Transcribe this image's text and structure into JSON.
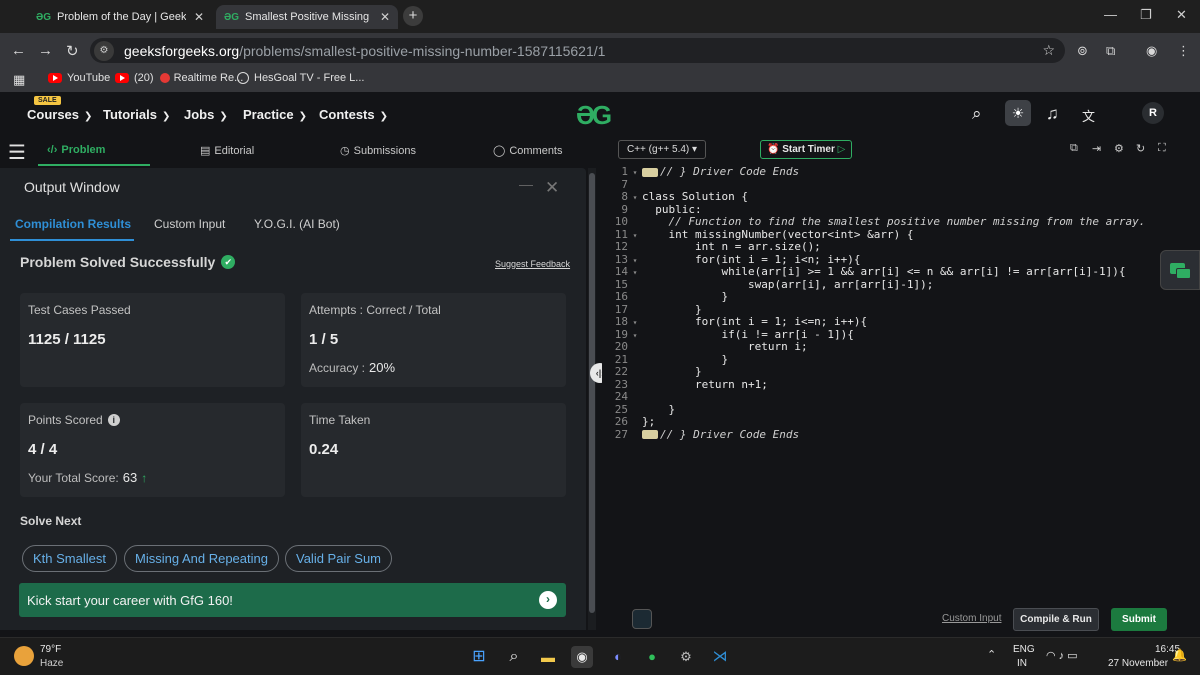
{
  "browser": {
    "tabs": [
      {
        "label": "Problem of the Day | GeeksforG",
        "active": false
      },
      {
        "label": "Smallest Positive Missing Numb",
        "active": true
      }
    ],
    "url_domain": "geeksforgeeks.org",
    "url_path": "/problems/smallest-positive-missing-number-1587115621/1",
    "bookmarks": [
      {
        "label": "YouTube",
        "icon": "youtube-icon"
      },
      {
        "label": "(20)",
        "icon": "youtube-icon"
      },
      {
        "label": "Realtime Re...",
        "icon": "red-dot-icon"
      },
      {
        "label": "HesGoal TV - Free L...",
        "icon": "globe-icon"
      }
    ]
  },
  "site_header": {
    "sale_badge": "SALE",
    "menus": [
      "Courses",
      "Tutorials",
      "Jobs",
      "Practice",
      "Contests"
    ],
    "logo": "GfG",
    "avatar_initial": "R"
  },
  "problem_tabs": {
    "problem": "Problem",
    "editorial": "Editorial",
    "submissions": "Submissions",
    "comments": "Comments"
  },
  "output_window": {
    "title": "Output Window",
    "tabs": [
      "Compilation Results",
      "Custom Input",
      "Y.O.G.I. (AI Bot)"
    ],
    "status": "Problem Solved Successfully",
    "suggest_feedback": "Suggest Feedback",
    "cards": {
      "test_cases_label": "Test Cases Passed",
      "test_cases_value": "1125 / 1125",
      "attempts_label": "Attempts : Correct / Total",
      "attempts_value": "1 / 5",
      "accuracy_label": "Accuracy :",
      "accuracy_value": "20%",
      "points_label": "Points Scored",
      "points_value": "4 / 4",
      "total_score_label": "Your Total Score:",
      "total_score_value": "63",
      "time_label": "Time Taken",
      "time_value": "0.24"
    },
    "solve_next_label": "Solve Next",
    "solve_next": [
      "Kth Smallest",
      "Missing And Repeating",
      "Valid Pair Sum"
    ],
    "banner": "Kick start your career with GfG 160!"
  },
  "editor": {
    "language": "C++ (g++ 5.4)",
    "start_timer": "Start Timer",
    "custom_input": "Custom Input",
    "compile_run": "Compile & Run",
    "submit": "Submit"
  },
  "code_lines": [
    {
      "n": "1",
      "text": "// } Driver Code Ends",
      "fold": true,
      "collapsed": true
    },
    {
      "n": "7",
      "text": "",
      "fold": false
    },
    {
      "n": "8",
      "text": "class Solution {",
      "fold": true
    },
    {
      "n": "9",
      "text": "  public:",
      "fold": false
    },
    {
      "n": "10",
      "text": "    // Function to find the smallest positive number missing from the array.",
      "fold": false
    },
    {
      "n": "11",
      "text": "    int missingNumber(vector<int> &arr) {",
      "fold": true
    },
    {
      "n": "12",
      "text": "        int n = arr.size();",
      "fold": false
    },
    {
      "n": "13",
      "text": "        for(int i = 1; i<n; i++){",
      "fold": true
    },
    {
      "n": "14",
      "text": "            while(arr[i] >= 1 && arr[i] <= n && arr[i] != arr[arr[i]-1]){",
      "fold": true
    },
    {
      "n": "15",
      "text": "                swap(arr[i], arr[arr[i]-1]);",
      "fold": false
    },
    {
      "n": "16",
      "text": "            }",
      "fold": false
    },
    {
      "n": "17",
      "text": "        }",
      "fold": false
    },
    {
      "n": "18",
      "text": "        for(int i = 1; i<=n; i++){",
      "fold": true
    },
    {
      "n": "19",
      "text": "            if(i != arr[i - 1]){",
      "fold": true
    },
    {
      "n": "20",
      "text": "                return i;",
      "fold": false
    },
    {
      "n": "21",
      "text": "            }",
      "fold": false
    },
    {
      "n": "22",
      "text": "        }",
      "fold": false
    },
    {
      "n": "23",
      "text": "        return n+1;",
      "fold": false
    },
    {
      "n": "24",
      "text": "",
      "fold": false
    },
    {
      "n": "25",
      "text": "    }",
      "fold": false
    },
    {
      "n": "26",
      "text": "};",
      "fold": false
    },
    {
      "n": "27",
      "text": "// } Driver Code Ends",
      "fold": false,
      "collapsed": true
    }
  ],
  "taskbar": {
    "temperature": "79°F",
    "condition": "Haze",
    "lang_line1": "ENG",
    "lang_line2": "IN",
    "time": "16:45",
    "date": "27 November"
  },
  "colors": {
    "accent_green": "#2fad62",
    "accent_blue": "#2f8fd6",
    "banner_green": "#1d6b4a",
    "submit_green": "#1c7a3f"
  }
}
